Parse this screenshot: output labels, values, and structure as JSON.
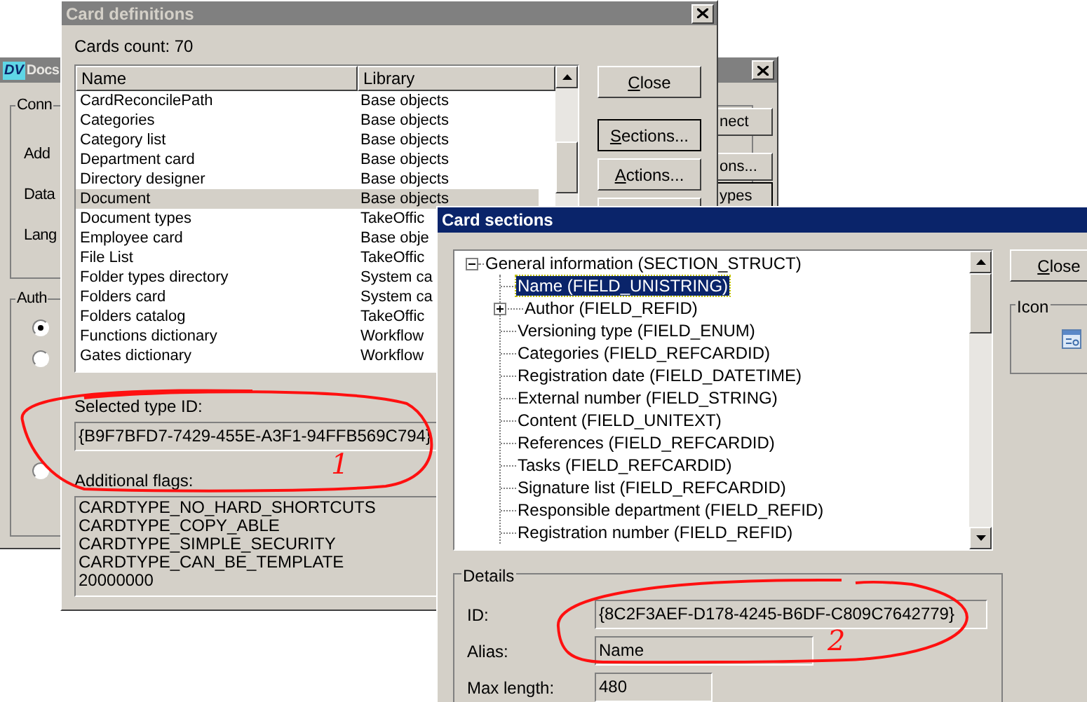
{
  "docs_window": {
    "logo": "DV",
    "title": "Docs",
    "connection_group": "Conn",
    "labels": [
      "Add",
      "Data",
      "Lang"
    ],
    "auth_group": "Auth",
    "radios": [
      {
        "selected": true
      },
      {
        "selected": false
      },
      {
        "selected": false
      }
    ],
    "buttons": [
      {
        "label": "nect",
        "default": false
      },
      {
        "label": "ons...",
        "default": false
      },
      {
        "label": "ypes",
        "default": true
      }
    ]
  },
  "card_definitions": {
    "title": "Card definitions",
    "count_label": "Cards count: 70",
    "columns": [
      "Name",
      "Library"
    ],
    "rows": [
      {
        "name": "CardReconcilePath",
        "library": "Base objects",
        "selected": false
      },
      {
        "name": "Categories",
        "library": "Base objects",
        "selected": false
      },
      {
        "name": "Category list",
        "library": "Base objects",
        "selected": false
      },
      {
        "name": "Department card",
        "library": "Base objects",
        "selected": false
      },
      {
        "name": "Directory designer",
        "library": "Base objects",
        "selected": false
      },
      {
        "name": "Document",
        "library": "Base objects",
        "selected": true
      },
      {
        "name": "Document types",
        "library": "TakeOffic",
        "selected": false
      },
      {
        "name": "Employee card",
        "library": "Base obje",
        "selected": false
      },
      {
        "name": "File List",
        "library": "TakeOffic",
        "selected": false
      },
      {
        "name": "Folder types directory",
        "library": "System ca",
        "selected": false
      },
      {
        "name": "Folders card",
        "library": "System ca",
        "selected": false
      },
      {
        "name": "Folders catalog",
        "library": "TakeOffic",
        "selected": false
      },
      {
        "name": "Functions dictionary",
        "library": "Workflow",
        "selected": false
      },
      {
        "name": "Gates dictionary",
        "library": "Workflow",
        "selected": false
      }
    ],
    "buttons": [
      {
        "label": "Close",
        "default": false
      },
      {
        "label": "Sections...",
        "default": true
      },
      {
        "label": "Actions...",
        "default": false
      }
    ],
    "selected_type_id_label": "Selected type ID:",
    "selected_type_id": "{B9F7BFD7-7429-455E-A3F1-94FFB569C794}",
    "flags_label": "Additional flags:",
    "flags": [
      "CARDTYPE_NO_HARD_SHORTCUTS",
      "CARDTYPE_COPY_ABLE",
      "CARDTYPE_SIMPLE_SECURITY",
      "CARDTYPE_CAN_BE_TEMPLATE",
      "20000000"
    ]
  },
  "card_sections": {
    "title": "Card sections",
    "tree": [
      {
        "label": "General information (SECTION_STRUCT)",
        "expanded": true,
        "selected": false,
        "children": [
          {
            "label": "Name (FIELD_UNISTRING)",
            "selected": true,
            "kind": "leaf"
          },
          {
            "label": "Author (FIELD_REFID)",
            "selected": false,
            "kind": "branch"
          },
          {
            "label": "Versioning type (FIELD_ENUM)",
            "selected": false,
            "kind": "leaf"
          },
          {
            "label": "Categories (FIELD_REFCARDID)",
            "selected": false,
            "kind": "leaf"
          },
          {
            "label": "Registration date (FIELD_DATETIME)",
            "selected": false,
            "kind": "leaf"
          },
          {
            "label": "External number (FIELD_STRING)",
            "selected": false,
            "kind": "leaf"
          },
          {
            "label": "Content (FIELD_UNITEXT)",
            "selected": false,
            "kind": "leaf"
          },
          {
            "label": "References (FIELD_REFCARDID)",
            "selected": false,
            "kind": "leaf"
          },
          {
            "label": "Tasks (FIELD_REFCARDID)",
            "selected": false,
            "kind": "leaf"
          },
          {
            "label": "Signature list (FIELD_REFCARDID)",
            "selected": false,
            "kind": "leaf"
          },
          {
            "label": "Responsible department (FIELD_REFID)",
            "selected": false,
            "kind": "leaf"
          },
          {
            "label": "Registration number (FIELD_REFID)",
            "selected": false,
            "kind": "leaf"
          }
        ]
      }
    ],
    "close_button": {
      "label": "Close"
    },
    "icon_group": "Icon",
    "details_group": "Details",
    "fields": [
      {
        "label": "ID:",
        "value": "{8C2F3AEF-D178-4245-B6DF-C809C7642779}"
      },
      {
        "label": "Alias:",
        "value": "Name"
      },
      {
        "label": "Max length:",
        "value": "480"
      }
    ]
  },
  "annotations": [
    {
      "label": "1"
    },
    {
      "label": "2"
    }
  ]
}
